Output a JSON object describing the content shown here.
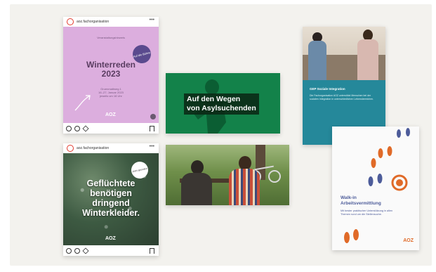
{
  "instagram_pink": {
    "handle": "aoz.fachorganisation",
    "top_line": "Veranstaltungshinweis",
    "title_line1": "Winterreden",
    "title_line2": "2023",
    "badge_text": "Auf die Bühne",
    "details_line1": "Gruenmattweg 1",
    "details_line2": "16.-27. Januar 2023",
    "details_line3": "jeweils um 18 Uhr",
    "logo": "AOZ"
  },
  "instagram_forest": {
    "handle": "aoz.fachorganisation",
    "sticker": "Jetzt spenden",
    "headline_line1": "Geflüchtete",
    "headline_line2": "benötigen",
    "headline_line3": "dringend",
    "headline_line4": "Winterkleider.",
    "logo": "AOZ"
  },
  "green_banner": {
    "title_line1": "Auf den Wegen",
    "title_line2": "von Asylsuchenden"
  },
  "brochure_teal": {
    "title": "GEP Soziale Integration",
    "body": "Die Fachorganisation AOZ unterstützt Menschen bei der sozialen Integration in unterschiedlichen Lebensbereichen."
  },
  "brochure_walkin": {
    "title_line1": "Walk-in",
    "title_line2": "Arbeitsvermittlung",
    "subtitle": "Mit bester praktischer Unterstützung in allen Themen rund um die Stellensuche.",
    "logo": "AOZ"
  },
  "colors": {
    "background": "#f3f2ee",
    "pink": "#dcaede",
    "green": "#13824a",
    "teal": "#25889a",
    "orange": "#e06a28",
    "navy": "#4d5c9a"
  },
  "icons": [
    "heart-icon",
    "comment-icon",
    "share-icon",
    "bookmark-icon",
    "arrow-icon",
    "footprint-icon",
    "target-icon"
  ]
}
